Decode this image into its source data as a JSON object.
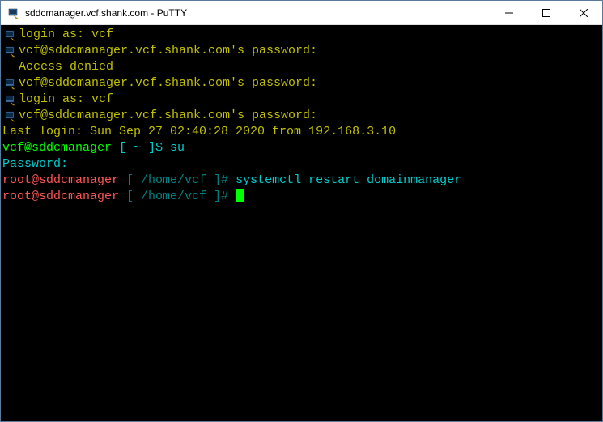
{
  "window": {
    "title": "sddcmanager.vcf.shank.com - PuTTY"
  },
  "lines": {
    "login1_prompt": "login as:",
    "login1_user": " vcf",
    "pw1": "vcf@sddcmanager.vcf.shank.com's password:",
    "denied": "Access denied",
    "pw2": "vcf@sddcmanager.vcf.shank.com's password:",
    "login2_prompt": "login as:",
    "login2_user": " vcf",
    "pw3": "vcf@sddcmanager.vcf.shank.com's password:",
    "lastlogin": "Last login: Sun Sep 27 02:40:28 2020 from 192.168.3.10",
    "user_prompt_user": "vcf@sddcmanager",
    "user_prompt_path": " [ ~ ]$ ",
    "su_cmd": "su",
    "passwd": "Password:",
    "root1_user": "root@sddcmanager",
    "root1_path": " [ /home/vcf ]# ",
    "root1_cmd": "systemctl restart domainmanager",
    "root2_user": "root@sddcmanager",
    "root2_path": " [ /home/vcf ]# "
  }
}
